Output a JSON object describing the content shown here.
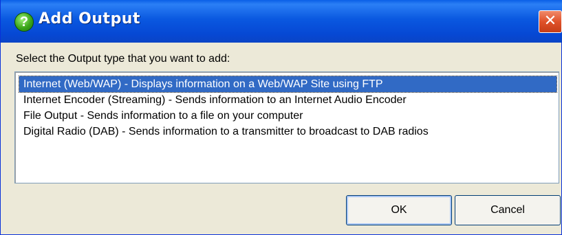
{
  "window": {
    "title": "Add Output",
    "title_icon": "help-icon",
    "close_icon": "close-icon",
    "close_glyph": "✕"
  },
  "prompt": "Select the Output type that you want to add:",
  "list": {
    "selected_index": 0,
    "items": [
      {
        "label": "Internet (Web/WAP) - Displays information on a Web/WAP Site using FTP"
      },
      {
        "label": "Internet Encoder (Streaming) - Sends information to an Internet Audio Encoder"
      },
      {
        "label": "File Output - Sends information to a file on your computer"
      },
      {
        "label": "Digital Radio (DAB) - Sends information to a transmitter to broadcast to DAB radios"
      }
    ]
  },
  "buttons": {
    "ok_label": "OK",
    "cancel_label": "Cancel"
  },
  "colors": {
    "titlebar": "#0a58e0",
    "selection": "#316ac5",
    "close": "#e0522a",
    "dialog_bg": "#ece9d8"
  }
}
